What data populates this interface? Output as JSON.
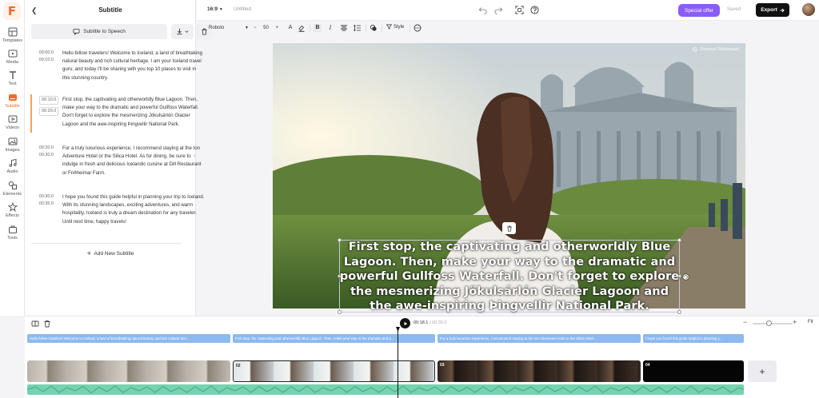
{
  "app": {
    "logo_letter": "F",
    "brand_color": "#f06a28"
  },
  "rail": {
    "items": [
      {
        "label": "Templates",
        "icon": "templates-icon"
      },
      {
        "label": "Media",
        "icon": "media-icon"
      },
      {
        "label": "Text",
        "icon": "text-icon"
      },
      {
        "label": "Subtitle",
        "icon": "subtitle-icon",
        "active": true
      },
      {
        "label": "Videos",
        "icon": "videos-icon"
      },
      {
        "label": "Images",
        "icon": "images-icon"
      },
      {
        "label": "Audio",
        "icon": "audio-icon"
      },
      {
        "label": "Elements",
        "icon": "elements-icon"
      },
      {
        "label": "Effects",
        "icon": "effects-icon"
      },
      {
        "label": "Tools",
        "icon": "tools-icon"
      }
    ]
  },
  "panel": {
    "title": "Subtitle",
    "speech_button": "Subtitle to Speech",
    "add_subtitle": "Add New Subtitle",
    "subtitles": [
      {
        "start": "00:00.0",
        "end": "00:10.0",
        "text": "Hello fellow travelers! Welcome to Iceland, a land of breathtaking natural beauty and rich cultural heritage. I am your Iceland travel guru, and today I'll be sharing with you top 10 places to visit in this stunning country."
      },
      {
        "start": "00:10.0",
        "end": "00:20.0",
        "text": "First stop, the captivating and otherworldly Blue Lagoon. Then, make your way to the dramatic and powerful Gullfoss Waterfall. Don't forget to explore the mesmerizing Jökulsárlón Glacier Lagoon and the awe-inspiring Þingvellir National Park."
      },
      {
        "start": "00:20.0",
        "end": "00:30.0",
        "text": "For a truly luxurious experience, I recommend staying at the Ion Adventure Hotel or the Silica Hotel. As for dining, be sure to indulge in fresh and delicious Icelandic cuisine at Dill Restaurant or Friðheimar Farm."
      },
      {
        "start": "00:30.0",
        "end": "00:35.0",
        "text": "I hope you found this guide helpful in planning your trip to Iceland. With its stunning landscapes, exciting adventures, and warm hospitality, Iceland is truly a dream destination for any traveler. Until next time, happy travels!"
      }
    ]
  },
  "topbar": {
    "ratio": "16:9",
    "doc_name": "Untitled",
    "special_offer": "Special offer",
    "saved": "Saved",
    "export": "Export",
    "special_color": "#8b5cf6"
  },
  "texttools": {
    "font": "Roboto",
    "size": "50",
    "style": "Style"
  },
  "canvas": {
    "watermark": "Remove Watermark",
    "caption": "First stop, the captivating and otherworldly Blue Lagoon. Then, make your way to the dramatic and powerful Gullfoss Waterfall. Don't forget to explore the mesmerizing Jökulsárlón Glacier Lagoon and the awe-inspiring Þingvellir National Park."
  },
  "timeline": {
    "current_time": "00:18.1",
    "total_time": "/ 00:35.0",
    "fit": "Fit",
    "sub_tracks": [
      "Hello fellow travelers! Welcome to Iceland, a land of breathtaking natural beauty and rich cultural heri...",
      "First stop, the captivating and otherworldly Blue Lagoon. Then, make your way to the dramatic and p...",
      "For a truly luxurious experience, I recommend staying at the Ion Adventure Hotel or the Silica Hotel...",
      "I hope you found this guide helpful in planning y..."
    ],
    "clips": [
      "",
      "02",
      "03",
      "04"
    ],
    "sub_color": "#8db9f0",
    "audio_color": "#76d2b0"
  }
}
